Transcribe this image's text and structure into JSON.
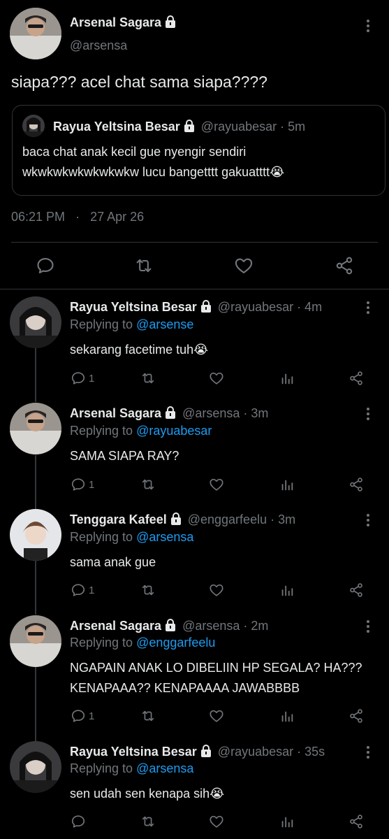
{
  "main_tweet": {
    "display_name": "Arsenal Sagara",
    "handle": "@arsensa",
    "text": "siapa??? acel chat sama siapa????",
    "time": "06:21 PM",
    "separator": "·",
    "date": "27 Apr 26",
    "quoted": {
      "display_name": "Rayua Yeltsina Besar",
      "handle": "@rayuabesar",
      "age": "· 5m",
      "line1": "baca chat anak kecil gue nyengir sendiri",
      "line2": "wkwkwkwkwkwkwkw lucu bangetttt gakuatttt😭"
    },
    "actions": [
      "reply-icon",
      "retweet-icon",
      "like-icon",
      "share-icon"
    ]
  },
  "replies": [
    {
      "display_name": "Rayua Yeltsina Besar",
      "handle": "@rayuabesar",
      "age": "· 4m",
      "replying_prefix": "Replying to",
      "replying_to": "@arsense",
      "text_lines": [
        "sekarang facetime tuh😭"
      ],
      "reply_count": "1"
    },
    {
      "display_name": "Arsenal Sagara",
      "handle": "@arsensa",
      "age": "· 3m",
      "replying_prefix": "Replying to",
      "replying_to": "@rayuabesar",
      "text_lines": [
        "SAMA SIAPA RAY?"
      ],
      "reply_count": "1"
    },
    {
      "display_name": "Tenggara Kafeel",
      "handle": "@enggarfeelu",
      "age": "· 3m",
      "replying_prefix": "Replying to",
      "replying_to": "@arsensa",
      "text_lines": [
        "sama anak gue"
      ],
      "reply_count": "1"
    },
    {
      "display_name": "Arsenal Sagara",
      "handle": "@arsensa",
      "age": "· 2m",
      "replying_prefix": "Replying to",
      "replying_to": "@enggarfeelu",
      "text_lines": [
        "NGAPAIN ANAK LO DIBELIIN HP SEGALA? HA???",
        "KENAPAAA?? KENAPAAAA JAWABBBB"
      ],
      "reply_count": "1"
    },
    {
      "display_name": "Rayua Yeltsina Besar",
      "handle": "@rayuabesar",
      "age": "· 35s",
      "replying_prefix": "Replying to",
      "replying_to": "@arsensa",
      "text_lines": [
        "sen udah sen kenapa sih😭"
      ],
      "reply_count": ""
    }
  ],
  "colors": {
    "background": "#000000",
    "text": "#e7e9ea",
    "muted": "#71767b",
    "link": "#1d9bf0",
    "border": "#2f3336"
  }
}
